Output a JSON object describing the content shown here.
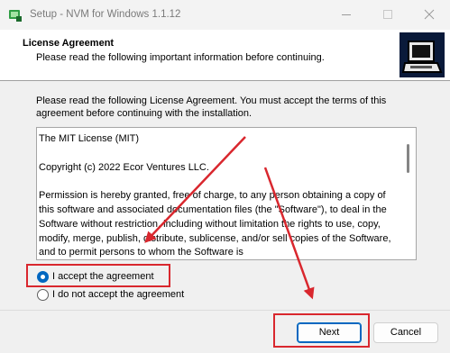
{
  "window": {
    "title": "Setup - NVM for Windows 1.1.12",
    "controls": [
      "minimize-icon",
      "maximize-icon",
      "close-icon"
    ]
  },
  "header": {
    "title": "License Agreement",
    "subtitle": "Please read the following important information before continuing."
  },
  "intro_text": "Please read the following License Agreement. You must accept the terms of this agreement before continuing with the installation.",
  "license": {
    "heading": "The MIT License (MIT)",
    "copyright": "Copyright (c) 2022 Ecor Ventures LLC.",
    "body": "Permission is hereby granted, free of charge, to any person obtaining a copy of this software and associated documentation files (the \"Software\"), to deal in the Software without restriction, including without limitation the rights to use, copy, modify, merge, publish, distribute, sublicense, and/or sell copies of the Software, and to permit persons to whom the Software is"
  },
  "options": {
    "accept_label": "I accept the agreement",
    "decline_label": "I do not accept the agreement",
    "selected": "accept"
  },
  "buttons": {
    "next_label": "Next",
    "cancel_label": "Cancel"
  },
  "colors": {
    "accent": "#0067c0",
    "annotation": "#d9272e"
  }
}
